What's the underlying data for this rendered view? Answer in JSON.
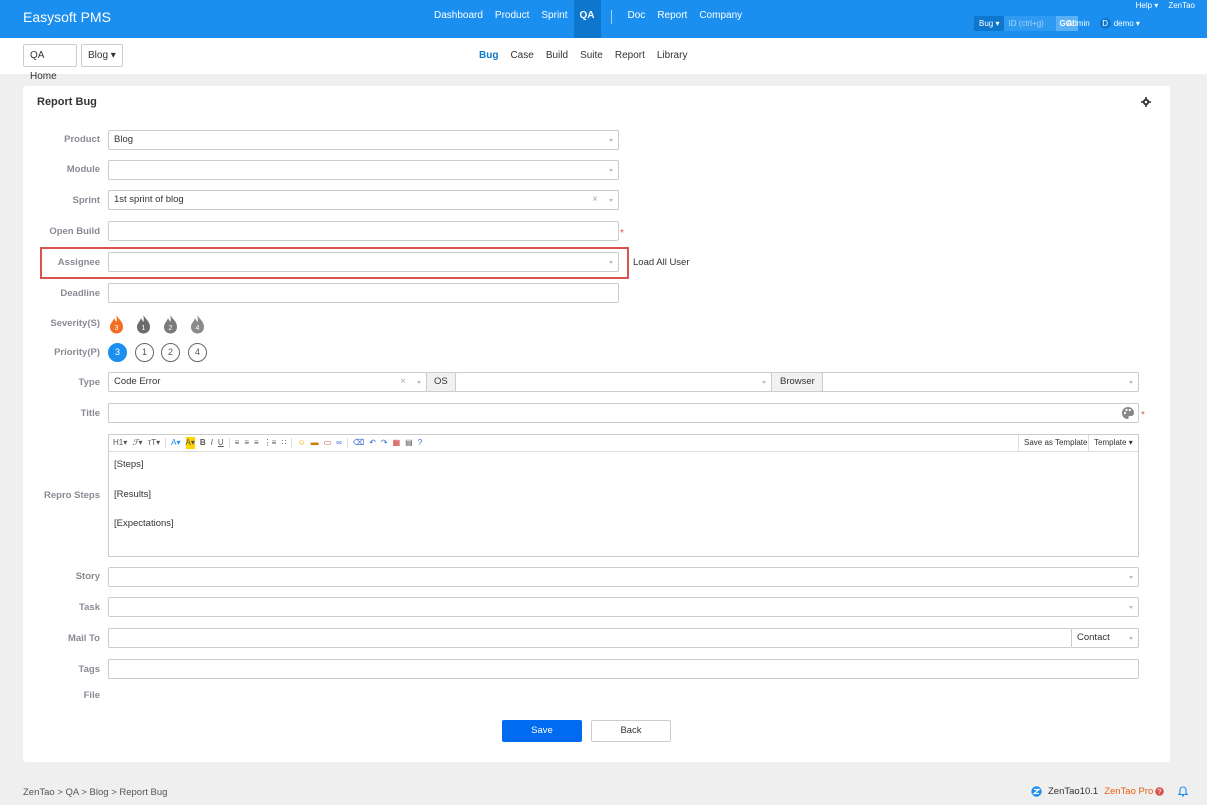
{
  "header": {
    "brand": "Easysoft PMS",
    "nav": [
      "Dashboard",
      "Product",
      "Sprint",
      "QA",
      "Doc",
      "Report",
      "Company"
    ],
    "active_nav": "QA",
    "help": "Help",
    "zentao": "ZenTao",
    "search_type": "Bug",
    "search_placeholder": "ID (ctrl+g)",
    "go": "GO!",
    "admin": "Admin",
    "avatar_letter": "D",
    "user": "demo"
  },
  "breadcrumb": {
    "home": "QA Home",
    "product": "Blog"
  },
  "subnav": {
    "items": [
      "Bug",
      "Case",
      "Build",
      "Suite",
      "Report",
      "Library"
    ],
    "active": "Bug"
  },
  "form": {
    "title": "Report Bug",
    "labels": {
      "product": "Product",
      "module": "Module",
      "sprint": "Sprint",
      "open_build": "Open Build",
      "assignee": "Assignee",
      "deadline": "Deadline",
      "severity": "Severity(S)",
      "priority": "Priority(P)",
      "type": "Type",
      "title": "Title",
      "repro_steps": "Repro Steps",
      "story": "Story",
      "task": "Task",
      "mail_to": "Mail To",
      "tags": "Tags",
      "file": "File"
    },
    "values": {
      "product": "Blog",
      "module": "",
      "sprint": "1st sprint of blog",
      "open_build": "",
      "assignee": "",
      "deadline": "",
      "type": "Code Error",
      "os": "",
      "browser": ""
    },
    "load_all_user": "Load All User",
    "os_label": "OS",
    "browser_label": "Browser",
    "severity_levels": [
      "3",
      "1",
      "2",
      "4"
    ],
    "priority_levels": [
      "3",
      "1",
      "2",
      "4"
    ],
    "contact": "Contact",
    "editor": {
      "save_template": "Save as Template",
      "template": "Template",
      "steps": "[Steps]",
      "results": "[Results]",
      "expectations": "[Expectations]"
    },
    "save": "Save",
    "back": "Back"
  },
  "footer": {
    "crumbs": "ZenTao > QA > Blog > Report Bug",
    "version": "ZenTao10.1",
    "pro": "ZenTao Pro"
  },
  "colors": {
    "header_bg": "#1a8ff0",
    "accent": "#006af1",
    "highlight_border": "#d9534f",
    "severity_active": "#f26e22",
    "severity_inactive": "#6b6b6b"
  }
}
